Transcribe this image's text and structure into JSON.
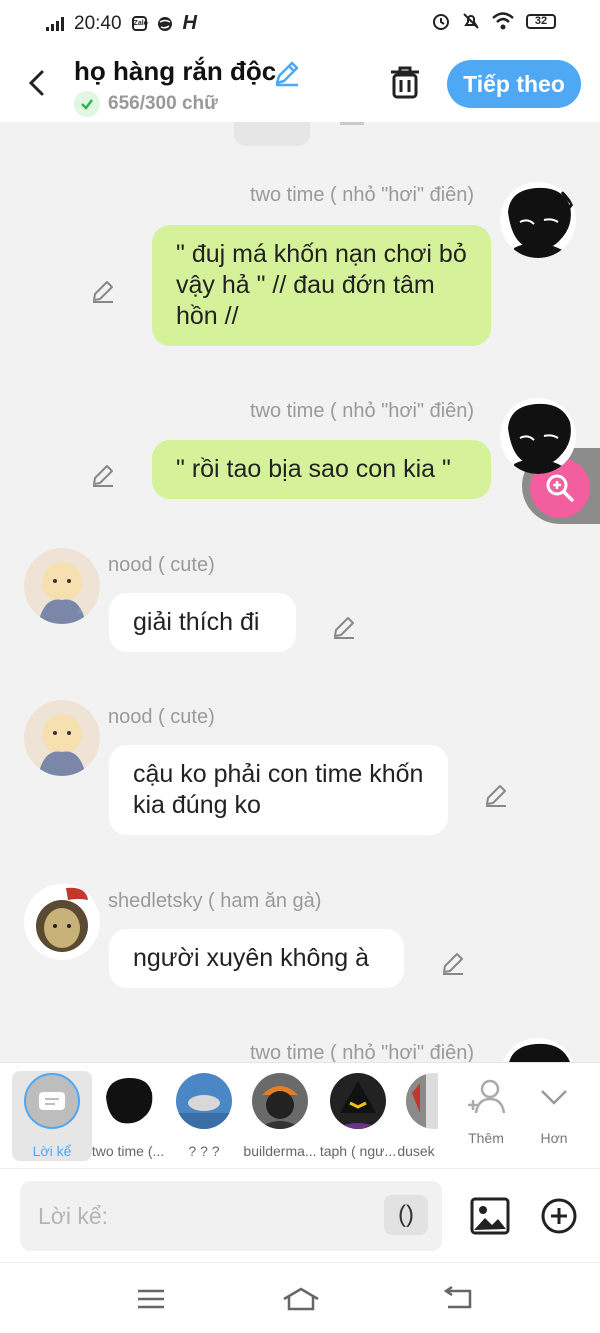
{
  "status_bar": {
    "time": "20:40",
    "mini_icon": "Zalo",
    "h_icon": "H",
    "battery": "32"
  },
  "header": {
    "title": "họ hàng rắn độc",
    "char_count": "656/300 chữ",
    "next_label": "Tiếp theo"
  },
  "messages": [
    {
      "speaker": "two time ( nhỏ \"hơi\" điên)",
      "text": "\" đuj má khốn nạn chơi bỏ vậy hả \" // đau đớn tâm hồn //",
      "side": "right"
    },
    {
      "speaker": "two time ( nhỏ \"hơi\" điên)",
      "text": "\" rồi tao bịa sao con kia \"",
      "side": "right"
    },
    {
      "speaker": "nood ( cute)",
      "text": "giải thích đi",
      "side": "left"
    },
    {
      "speaker": "nood ( cute)",
      "text": "cậu ko phải con time khốn kia đúng ko",
      "side": "left"
    },
    {
      "speaker": "shedletsky ( ham ăn gà)",
      "text": "người xuyên không à",
      "side": "left"
    },
    {
      "speaker": "two time ( nhỏ \"hơi\" điên)",
      "text": "",
      "side": "right"
    }
  ],
  "characters": [
    {
      "name": "Lời kể",
      "selected": true
    },
    {
      "name": "two time (..."
    },
    {
      "name": "? ? ?"
    },
    {
      "name": "builderma..."
    },
    {
      "name": "taph ( ngư..."
    },
    {
      "name": "dusek"
    }
  ],
  "bar_buttons": {
    "add_label": "Thêm",
    "more_label": "Hơn"
  },
  "input": {
    "placeholder": "Lời kể:",
    "paren_label": "()"
  },
  "colors": {
    "accent": "#4fa8f3",
    "green_bubble": "#d5f29a",
    "zoom": "#f25e9e"
  }
}
